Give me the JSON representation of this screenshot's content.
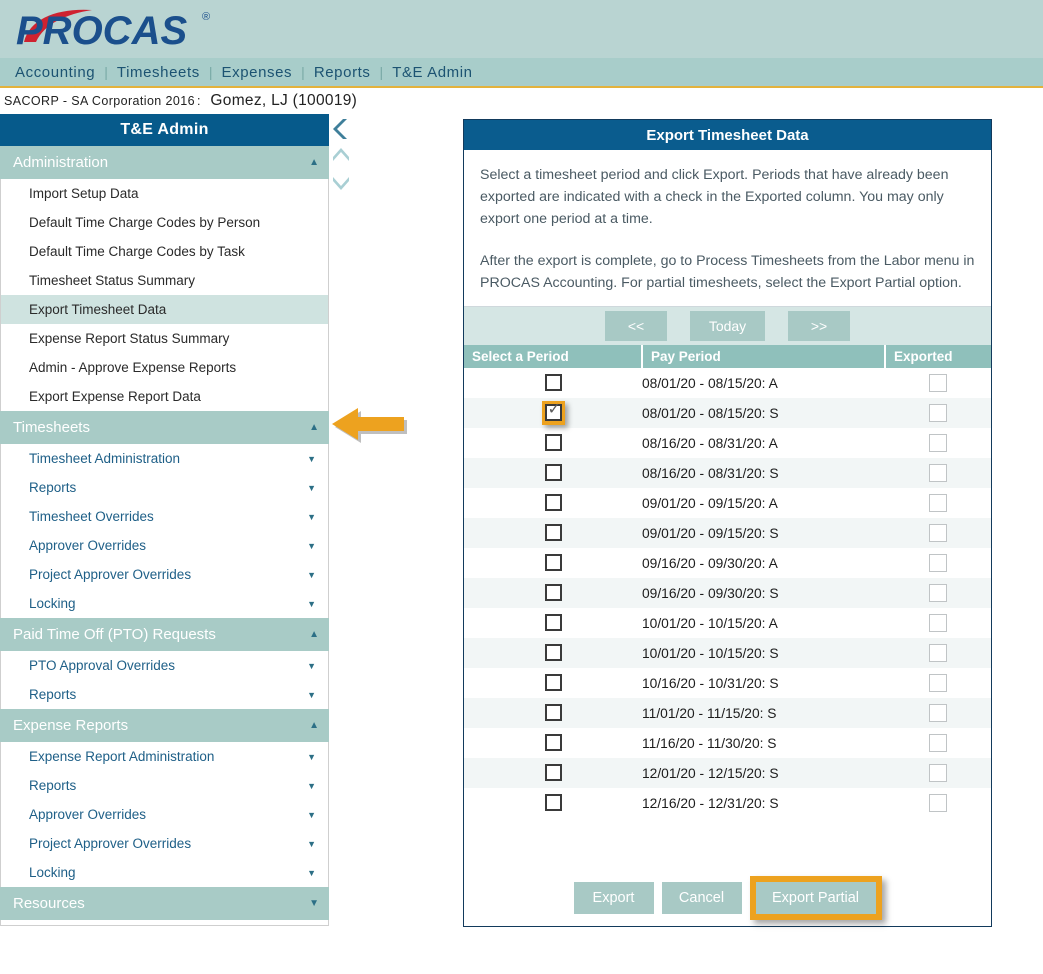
{
  "brand": {
    "logo_text": "PROCAS",
    "logo_reg": "®",
    "colors": {
      "logo_blue": "#1b4f8c",
      "logo_red": "#cf2230",
      "nav_band": "#a8cdca",
      "nav_underline": "#e3b23c",
      "sidebar_title": "#065a8b",
      "sidebar_group": "#a8cbc6",
      "dialog_title": "#0a5c8e",
      "table_header": "#8fc0bb",
      "highlight_orange": "#eda21f",
      "button_teal": "#a8c9c5"
    }
  },
  "top_nav": {
    "items": [
      {
        "label": "Accounting"
      },
      {
        "label": "Timesheets"
      },
      {
        "label": "Expenses"
      },
      {
        "label": "Reports"
      },
      {
        "label": "T&E Admin"
      }
    ],
    "separator": "|"
  },
  "breadcrumb": {
    "company": "SACORP - SA Corporation 2016",
    "colon": ":",
    "user": "Gomez, LJ (100019)"
  },
  "sidebar": {
    "title": "T&E Admin",
    "groups": [
      {
        "label": "Administration",
        "caret": "▲",
        "items": [
          {
            "label": "Import Setup Data",
            "caret": "",
            "style": "plain",
            "active": false
          },
          {
            "label": "Default Time Charge Codes by Person",
            "caret": "",
            "style": "plain",
            "active": false
          },
          {
            "label": "Default Time Charge Codes by Task",
            "caret": "",
            "style": "plain",
            "active": false
          },
          {
            "label": "Timesheet Status Summary",
            "caret": "",
            "style": "plain",
            "active": false
          },
          {
            "label": "Export Timesheet Data",
            "caret": "",
            "style": "plain",
            "active": true
          },
          {
            "label": "Expense Report Status Summary",
            "caret": "",
            "style": "plain",
            "active": false
          },
          {
            "label": "Admin - Approve Expense Reports",
            "caret": "",
            "style": "plain",
            "active": false
          },
          {
            "label": "Export Expense Report Data",
            "caret": "",
            "style": "plain",
            "active": false
          }
        ]
      },
      {
        "label": "Timesheets",
        "caret": "▲",
        "items": [
          {
            "label": "Timesheet Administration",
            "caret": "▼",
            "style": "link",
            "active": false
          },
          {
            "label": "Reports",
            "caret": "▼",
            "style": "link",
            "active": false
          },
          {
            "label": "Timesheet Overrides",
            "caret": "▼",
            "style": "link",
            "active": false
          },
          {
            "label": "Approver Overrides",
            "caret": "▼",
            "style": "link",
            "active": false
          },
          {
            "label": "Project Approver Overrides",
            "caret": "▼",
            "style": "link",
            "active": false
          },
          {
            "label": "Locking",
            "caret": "▼",
            "style": "link",
            "active": false
          }
        ]
      },
      {
        "label": "Paid Time Off (PTO) Requests",
        "caret": "▲",
        "items": [
          {
            "label": "PTO Approval Overrides",
            "caret": "▼",
            "style": "link",
            "active": false
          },
          {
            "label": "Reports",
            "caret": "▼",
            "style": "link",
            "active": false
          }
        ]
      },
      {
        "label": "Expense Reports",
        "caret": "▲",
        "items": [
          {
            "label": "Expense Report Administration",
            "caret": "▼",
            "style": "link",
            "active": false
          },
          {
            "label": "Reports",
            "caret": "▼",
            "style": "link",
            "active": false
          },
          {
            "label": "Approver Overrides",
            "caret": "▼",
            "style": "link",
            "active": false
          },
          {
            "label": "Project Approver Overrides",
            "caret": "▼",
            "style": "link",
            "active": false
          },
          {
            "label": "Locking",
            "caret": "▼",
            "style": "link",
            "active": false
          }
        ]
      },
      {
        "label": "Resources",
        "caret": "▼",
        "items": []
      }
    ]
  },
  "rail": {
    "collapse_icon": "❮",
    "up_icon": "❮",
    "down_icon": "❮"
  },
  "annotations": {
    "arrow_direction": "left",
    "arrow_color": "#eda21f"
  },
  "dialog": {
    "title": "Export Timesheet Data",
    "paragraph1": "Select a timesheet period and click Export. Periods that have already been exported are indicated with a check in the Exported column. You may only export one period at a time.",
    "paragraph2": "After the export is complete, go to Process Timesheets from the Labor menu in PROCAS Accounting. For partial timesheets, select the Export Partial option.",
    "pager": {
      "prev_label": "<<",
      "today_label": "Today",
      "next_label": ">>"
    },
    "table": {
      "headers": {
        "select": "Select a Period",
        "pay_period": "Pay Period",
        "exported": "Exported"
      },
      "rows": [
        {
          "pay_period": "08/01/20 - 08/15/20: A",
          "selected": false,
          "highlighted": false,
          "exported": false
        },
        {
          "pay_period": "08/01/20 - 08/15/20: S",
          "selected": true,
          "highlighted": true,
          "exported": false
        },
        {
          "pay_period": "08/16/20 - 08/31/20: A",
          "selected": false,
          "highlighted": false,
          "exported": false
        },
        {
          "pay_period": "08/16/20 - 08/31/20: S",
          "selected": false,
          "highlighted": false,
          "exported": false
        },
        {
          "pay_period": "09/01/20 - 09/15/20: A",
          "selected": false,
          "highlighted": false,
          "exported": false
        },
        {
          "pay_period": "09/01/20 - 09/15/20: S",
          "selected": false,
          "highlighted": false,
          "exported": false
        },
        {
          "pay_period": "09/16/20 - 09/30/20: A",
          "selected": false,
          "highlighted": false,
          "exported": false
        },
        {
          "pay_period": "09/16/20 - 09/30/20: S",
          "selected": false,
          "highlighted": false,
          "exported": false
        },
        {
          "pay_period": "10/01/20 - 10/15/20: A",
          "selected": false,
          "highlighted": false,
          "exported": false
        },
        {
          "pay_period": "10/01/20 - 10/15/20: S",
          "selected": false,
          "highlighted": false,
          "exported": false
        },
        {
          "pay_period": "10/16/20 - 10/31/20: S",
          "selected": false,
          "highlighted": false,
          "exported": false
        },
        {
          "pay_period": "11/01/20 - 11/15/20: S",
          "selected": false,
          "highlighted": false,
          "exported": false
        },
        {
          "pay_period": "11/16/20 - 11/30/20: S",
          "selected": false,
          "highlighted": false,
          "exported": false
        },
        {
          "pay_period": "12/01/20 - 12/15/20: S",
          "selected": false,
          "highlighted": false,
          "exported": false
        },
        {
          "pay_period": "12/16/20 - 12/31/20: S",
          "selected": false,
          "highlighted": false,
          "exported": false
        }
      ],
      "check_glyph": "✓"
    },
    "footer": {
      "export_label": "Export",
      "cancel_label": "Cancel",
      "export_partial_label": "Export Partial",
      "export_partial_highlighted": true
    }
  }
}
